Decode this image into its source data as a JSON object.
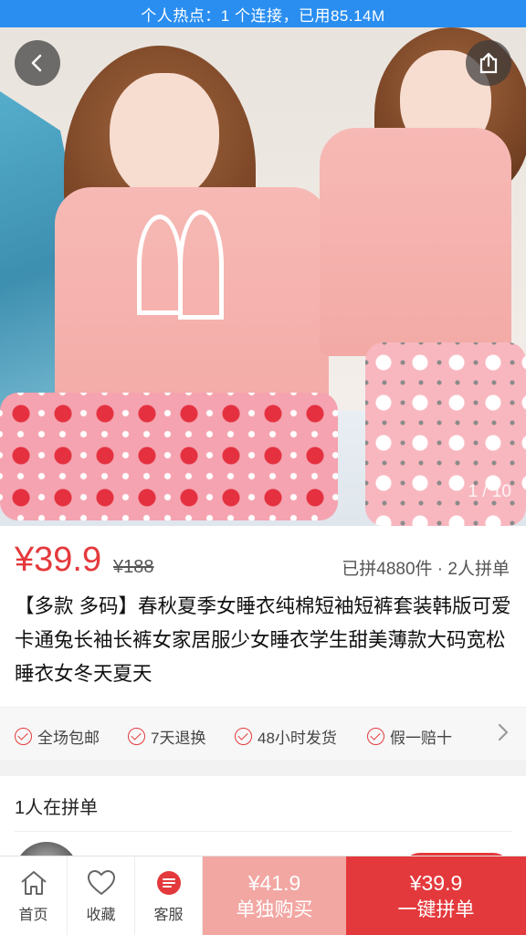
{
  "status_bar": {
    "text": "个人热点：1 个连接，已用85.14M"
  },
  "gallery": {
    "pager": "1 / 10",
    "back_icon": "chevron-left-icon",
    "share_icon": "share-icon"
  },
  "product": {
    "price": "¥39.9",
    "original_price": "¥188",
    "sold_info": "已拼4880件 · 2人拼单",
    "title": "【多款 多码】春秋夏季女睡衣纯棉短袖短裤套装韩版可爱卡通兔长袖长裤女家居服少女睡衣学生甜美薄款大码宽松睡衣女冬天夏天"
  },
  "promises": {
    "items": [
      {
        "label": "全场包邮"
      },
      {
        "label": "7天退换"
      },
      {
        "label": "48小时发货"
      },
      {
        "label": "假一赔十"
      }
    ],
    "more_icon": "chevron-right-icon"
  },
  "group": {
    "title": "1人在拼单"
  },
  "bottom_nav": {
    "home": "首页",
    "favorite": "收藏",
    "service": "客服",
    "buy_alone_price": "¥41.9",
    "buy_alone_label": "单独购买",
    "buy_group_price": "¥39.9",
    "buy_group_label": "一键拼单"
  },
  "colors": {
    "accent": "#e4393c",
    "accent_light": "#f2a7a3",
    "status_bar": "#2a8ef0"
  }
}
